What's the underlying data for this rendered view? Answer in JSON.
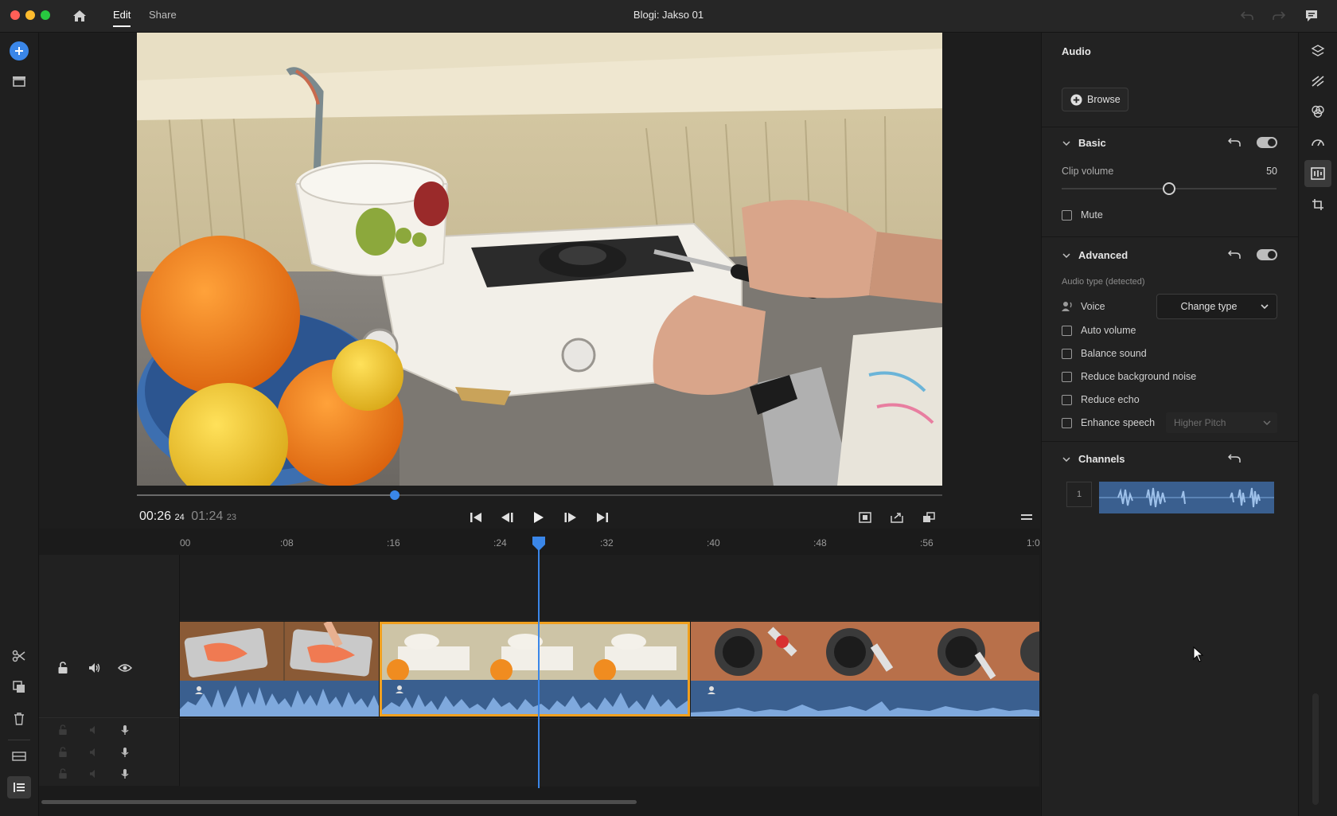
{
  "app": {
    "window_title": "Blogi: Jakso 01",
    "tabs": [
      {
        "label": "Edit"
      },
      {
        "label": "Share"
      }
    ]
  },
  "monitor": {
    "current_time": "00:26",
    "current_frames": "24",
    "duration": "01:24",
    "duration_frames": "23",
    "progress_fraction": 0.32
  },
  "timeline": {
    "ruler_labels": [
      "00",
      ":08",
      ":16",
      ":24",
      ":32",
      ":40",
      ":48",
      ":56",
      "1:0"
    ],
    "playhead_fraction": 0.417
  },
  "audio_panel": {
    "title": "Audio",
    "browse_label": "Browse",
    "basic": {
      "title": "Basic",
      "clip_volume_label": "Clip volume",
      "clip_volume_value": "50",
      "clip_volume_fraction": 0.5,
      "mute_label": "Mute"
    },
    "advanced": {
      "title": "Advanced",
      "audio_type_label": "Audio type (detected)",
      "voice_label": "Voice",
      "change_type_label": "Change type",
      "auto_volume_label": "Auto volume",
      "balance_sound_label": "Balance sound",
      "reduce_noise_label": "Reduce background noise",
      "reduce_echo_label": "Reduce echo",
      "enhance_speech_label": "Enhance speech",
      "enhance_speech_option": "Higher Pitch"
    },
    "channels": {
      "title": "Channels",
      "channel_number": "1"
    }
  },
  "colors": {
    "accent_blue": "#3a86e8",
    "selection_orange": "#f0a020",
    "audio_clip_blue": "#3a5f8f",
    "waveform_blue": "#7fa9dd"
  }
}
